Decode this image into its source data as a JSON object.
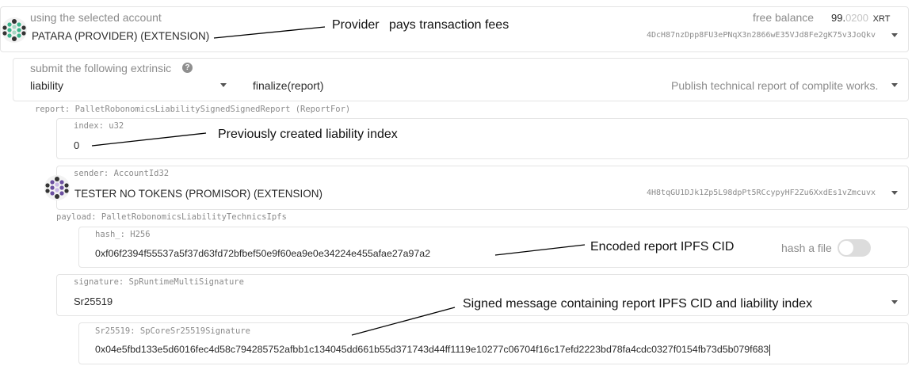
{
  "account": {
    "label": "using the selected account",
    "name": "PATARA (PROVIDER) (EXTENSION)",
    "address": "4DcH87nzDpp8FU3ePNqX3n2866wE35VJd8Fe2gK75v3JoQkv",
    "balance_label": "free balance",
    "balance_int": "99.",
    "balance_frac": "0200",
    "balance_unit": "XRT"
  },
  "extrinsic": {
    "label": "submit the following extrinsic",
    "help_icon": "?",
    "pallet": "liability",
    "method": "finalize(report)",
    "description": "Publish technical report of complite works."
  },
  "report": {
    "label": "report: PalletRobonomicsLiabilitySignedSignedReport (ReportFor)"
  },
  "index": {
    "label": "index: u32",
    "value": "0"
  },
  "sender": {
    "label": "sender: AccountId32",
    "name": "TESTER NO TOKENS (PROMISOR) (EXTENSION)",
    "address": "4H8tqGU1DJk1Zp5L98dpPt5RCcypyHF2Zu6XxdEs1vZmcuvx"
  },
  "payload": {
    "label": "payload: PalletRobonomicsLiabilityTechnicsIpfs"
  },
  "hash": {
    "label": "hash_: H256",
    "value": "0xf06f2394f55537a5f37d63fd72bfbef50e9f60ea9e0e34224e455afae27a97a2",
    "toggle_label": "hash a file"
  },
  "signature": {
    "label": "signature: SpRuntimeMultiSignature",
    "value": "Sr25519"
  },
  "sr25519": {
    "label": "Sr25519: SpCoreSr25519Signature",
    "value": "0x04e5fbd133e5d6016fec4d58c794285752afbb1c134045dd661b55d371743d44ff1119e10277c06704f16c17efd2223bd78fa4cdc0327f0154fb73d5b079f683"
  },
  "annotations": {
    "provider_a": "Provider",
    "provider_b": "pays transaction fees",
    "index": "Previously created liability index",
    "cid": "Encoded report IPFS CID",
    "signed": "Signed message containing report IPFS CID and liability index"
  },
  "colors": {
    "border": "#e4e4e4",
    "label": "#8b8b8b",
    "text": "#2b2b2b",
    "toggle_off": "#dcdcdc",
    "avatar_green": "#3bb38a",
    "avatar_purple": "#6b4fa0"
  }
}
